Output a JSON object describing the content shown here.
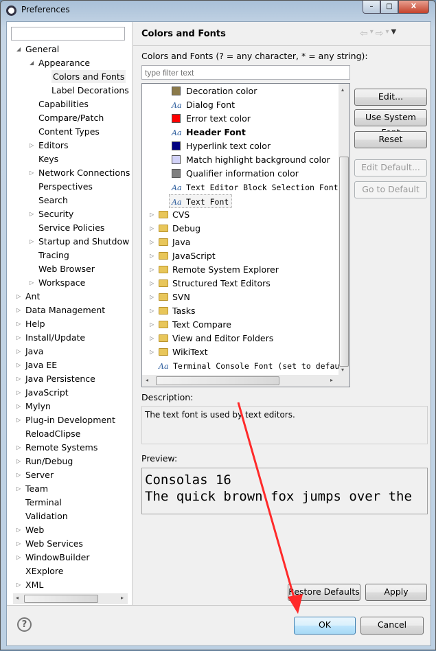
{
  "window": {
    "title": "Preferences",
    "min": "–",
    "max": "□",
    "close": "X"
  },
  "left": {
    "filter_value": "",
    "items": [
      {
        "label": "General",
        "level": 0,
        "arrow": "open"
      },
      {
        "label": "Appearance",
        "level": 1,
        "arrow": "open"
      },
      {
        "label": "Colors and Fonts",
        "level": 2,
        "arrow": "",
        "selected": true
      },
      {
        "label": "Label Decorations",
        "level": 2,
        "arrow": ""
      },
      {
        "label": "Capabilities",
        "level": 1,
        "arrow": ""
      },
      {
        "label": "Compare/Patch",
        "level": 1,
        "arrow": ""
      },
      {
        "label": "Content Types",
        "level": 1,
        "arrow": ""
      },
      {
        "label": "Editors",
        "level": 1,
        "arrow": "closed"
      },
      {
        "label": "Keys",
        "level": 1,
        "arrow": ""
      },
      {
        "label": "Network Connections",
        "level": 1,
        "arrow": "closed"
      },
      {
        "label": "Perspectives",
        "level": 1,
        "arrow": ""
      },
      {
        "label": "Search",
        "level": 1,
        "arrow": ""
      },
      {
        "label": "Security",
        "level": 1,
        "arrow": "closed"
      },
      {
        "label": "Service Policies",
        "level": 1,
        "arrow": ""
      },
      {
        "label": "Startup and Shutdow",
        "level": 1,
        "arrow": "closed"
      },
      {
        "label": "Tracing",
        "level": 1,
        "arrow": ""
      },
      {
        "label": "Web Browser",
        "level": 1,
        "arrow": ""
      },
      {
        "label": "Workspace",
        "level": 1,
        "arrow": "closed"
      },
      {
        "label": "Ant",
        "level": 0,
        "arrow": "closed"
      },
      {
        "label": "Data Management",
        "level": 0,
        "arrow": "closed"
      },
      {
        "label": "Help",
        "level": 0,
        "arrow": "closed"
      },
      {
        "label": "Install/Update",
        "level": 0,
        "arrow": "closed"
      },
      {
        "label": "Java",
        "level": 0,
        "arrow": "closed"
      },
      {
        "label": "Java EE",
        "level": 0,
        "arrow": "closed"
      },
      {
        "label": "Java Persistence",
        "level": 0,
        "arrow": "closed"
      },
      {
        "label": "JavaScript",
        "level": 0,
        "arrow": "closed"
      },
      {
        "label": "Mylyn",
        "level": 0,
        "arrow": "closed"
      },
      {
        "label": "Plug-in Development",
        "level": 0,
        "arrow": "closed"
      },
      {
        "label": "ReloadClipse",
        "level": 0,
        "arrow": ""
      },
      {
        "label": "Remote Systems",
        "level": 0,
        "arrow": "closed"
      },
      {
        "label": "Run/Debug",
        "level": 0,
        "arrow": "closed"
      },
      {
        "label": "Server",
        "level": 0,
        "arrow": "closed"
      },
      {
        "label": "Team",
        "level": 0,
        "arrow": "closed"
      },
      {
        "label": "Terminal",
        "level": 0,
        "arrow": ""
      },
      {
        "label": "Validation",
        "level": 0,
        "arrow": ""
      },
      {
        "label": "Web",
        "level": 0,
        "arrow": "closed"
      },
      {
        "label": "Web Services",
        "level": 0,
        "arrow": "closed"
      },
      {
        "label": "WindowBuilder",
        "level": 0,
        "arrow": "closed"
      },
      {
        "label": "XExplore",
        "level": 0,
        "arrow": ""
      },
      {
        "label": "XML",
        "level": 0,
        "arrow": "closed"
      }
    ]
  },
  "right": {
    "title": "Colors and Fonts",
    "nav": {
      "back": "⇦",
      "forward": "⇨",
      "dropdown": "▾",
      "menu": "▼"
    },
    "filter_label": "Colors and Fonts (? = any character, * = any string):",
    "filter_placeholder": "type filter text",
    "items": [
      {
        "label": "Decoration color",
        "kind": "color",
        "color": "#8b7a4a"
      },
      {
        "label": "Dialog Font",
        "kind": "font"
      },
      {
        "label": "Error text color",
        "kind": "color",
        "color": "#ff0000"
      },
      {
        "label": "Header Font",
        "kind": "font",
        "bold": true
      },
      {
        "label": "Hyperlink text color",
        "kind": "color",
        "color": "#000080"
      },
      {
        "label": "Match highlight background color",
        "kind": "color",
        "color": "#d2d2f8"
      },
      {
        "label": "Qualifier information color",
        "kind": "color",
        "color": "#808080"
      },
      {
        "label": "Text Editor Block Selection Font",
        "kind": "font",
        "mono": true
      },
      {
        "label": "Text Font",
        "kind": "font",
        "mono": true,
        "selected": true
      },
      {
        "label": "CVS",
        "kind": "folder"
      },
      {
        "label": "Debug",
        "kind": "folder"
      },
      {
        "label": "Java",
        "kind": "folder"
      },
      {
        "label": "JavaScript",
        "kind": "folder"
      },
      {
        "label": "Remote System Explorer",
        "kind": "folder"
      },
      {
        "label": "Structured Text Editors",
        "kind": "folder"
      },
      {
        "label": "SVN",
        "kind": "folder"
      },
      {
        "label": "Tasks",
        "kind": "folder"
      },
      {
        "label": "Text Compare",
        "kind": "folder"
      },
      {
        "label": "View and Editor Folders",
        "kind": "folder"
      },
      {
        "label": "WikiText",
        "kind": "folder"
      },
      {
        "label": "Terminal Console Font (set to defau",
        "kind": "font",
        "mono": true,
        "top": true
      }
    ],
    "buttons": {
      "edit": "Edit...",
      "use_system_font": "Use System Font",
      "reset": "Reset",
      "edit_default": "Edit Default...",
      "go_to_default": "Go to Default"
    },
    "description_label": "Description:",
    "description": "The text font is used by text editors.",
    "preview_label": "Preview:",
    "preview_line1": "Consolas 16",
    "preview_line2": "The quick brown fox jumps over the",
    "restore_defaults": "Restore Defaults",
    "apply": "Apply"
  },
  "footer": {
    "ok": "OK",
    "cancel": "Cancel"
  },
  "annotation": {
    "arrow_color": "#ff2a2a"
  }
}
